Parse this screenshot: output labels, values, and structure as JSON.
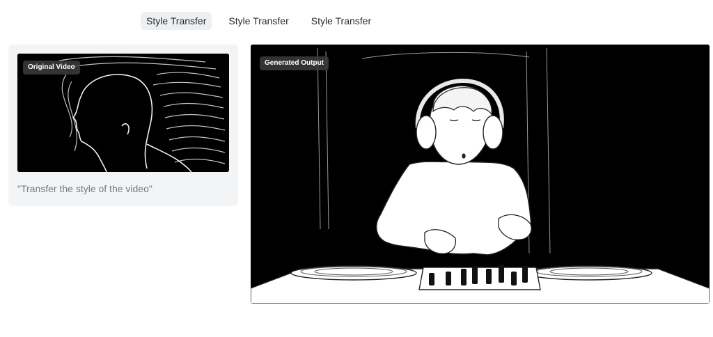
{
  "tabs": [
    {
      "label": "Style Transfer",
      "active": true
    },
    {
      "label": "Style Transfer",
      "active": false
    },
    {
      "label": "Style Transfer",
      "active": false
    }
  ],
  "input_panel": {
    "badge": "Original Video",
    "prompt": "\"Transfer the style of the video\""
  },
  "output_panel": {
    "badge": "Generated Output"
  },
  "colors": {
    "active_tab_bg": "#eeeff1",
    "card_bg": "#f3f4f6",
    "video_bg": "#000000",
    "badge_bg": "#3c3c3c"
  }
}
